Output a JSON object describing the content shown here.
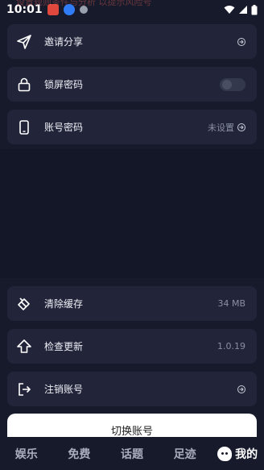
{
  "status_bar": {
    "time": "10:01",
    "ghost_text": "设置规则条件与分析 以提示风险号"
  },
  "settings": {
    "invite": {
      "label": "邀请分享",
      "icon": "paper-plane-icon"
    },
    "lock_password": {
      "label": "锁屏密码",
      "icon": "lock-icon",
      "toggle_on": false
    },
    "account_password": {
      "label": "账号密码",
      "icon": "phone-icon",
      "value": "未设置"
    },
    "clear_cache": {
      "label": "清除缓存",
      "icon": "eraser-icon",
      "value": "34 MB"
    },
    "check_update": {
      "label": "检查更新",
      "icon": "upload-arrow-icon",
      "value": "1.0.19"
    },
    "logout_account": {
      "label": "注销账号",
      "icon": "logout-icon"
    }
  },
  "switch_account_label": "切换账号",
  "bottom_nav": {
    "items": [
      "娱乐",
      "免费",
      "话题",
      "足迹",
      "我的"
    ],
    "active_index": 4
  },
  "colors": {
    "background": "#171a2b",
    "card": "#22253a",
    "accent_white": "#ffffff"
  }
}
